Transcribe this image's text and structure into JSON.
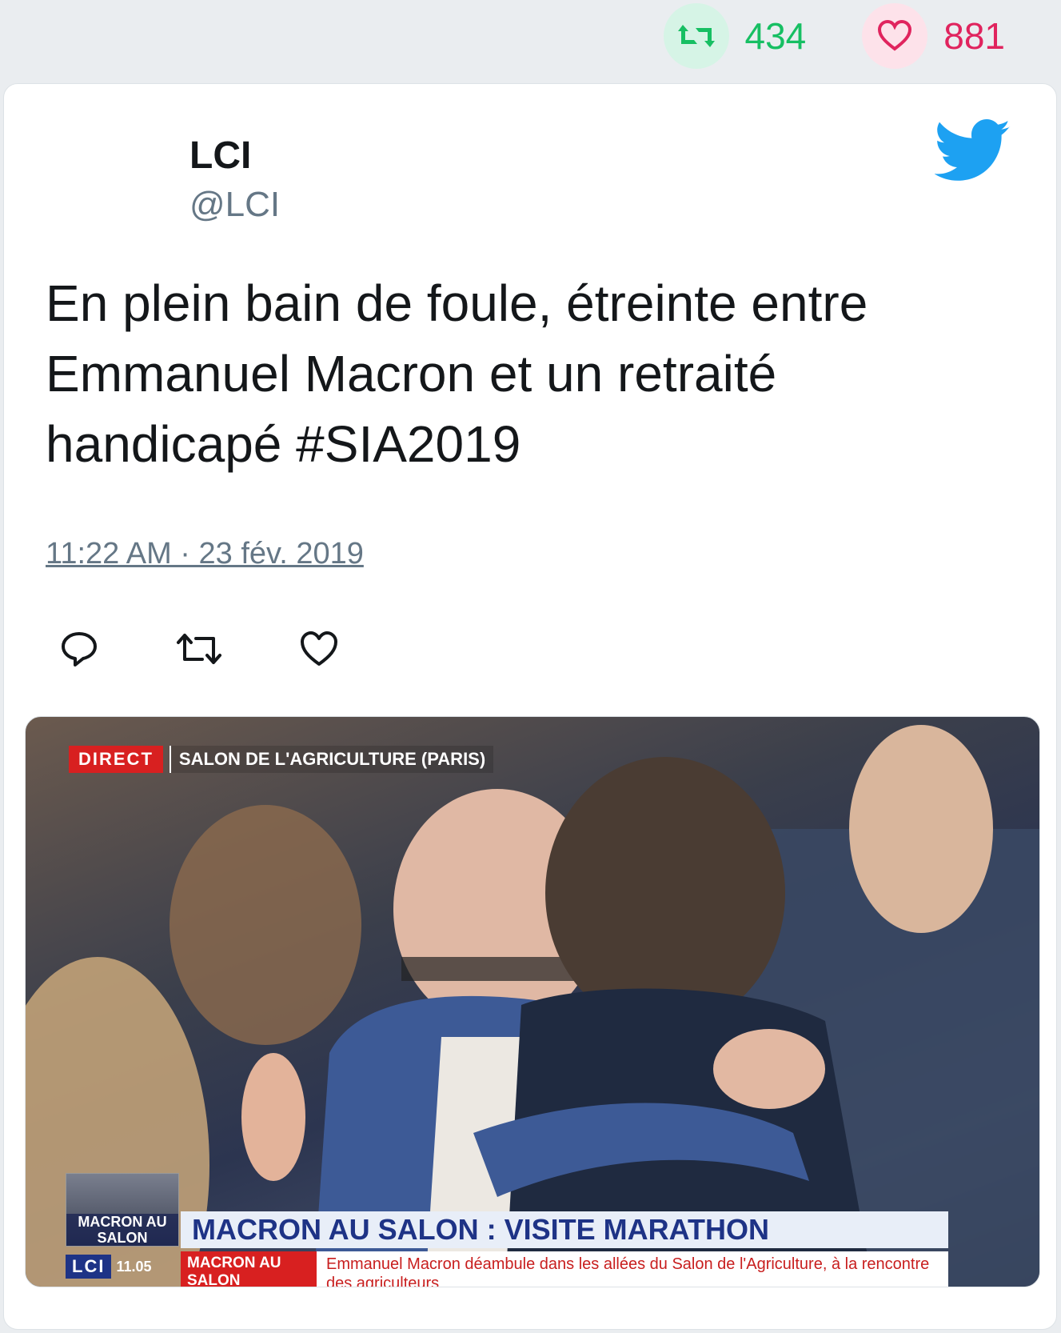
{
  "stats": {
    "retweet_count": "434",
    "like_count": "881",
    "retweet_color": "#17bf63",
    "like_color": "#e0245e"
  },
  "tweet": {
    "author_name": "LCI",
    "author_handle": "@LCI",
    "text": "En plein bain de foule, étreinte entre Emmanuel Macron et un retraité handicapé #SIA2019",
    "timestamp": "11:22 AM · 23 fév. 2019",
    "icons": [
      "reply-icon",
      "retweet-icon",
      "like-icon",
      "twitter-bird-icon"
    ]
  },
  "media": {
    "live_label": "DIRECT",
    "location": "SALON DE L'AGRICULTURE (PARIS)",
    "thumb_label": "MACRON AU SALON",
    "headline": "MACRON AU SALON : VISITE MARATHON",
    "channel": "LCI",
    "clock": "11.05",
    "subtopic": "MACRON AU SALON",
    "subtitle": "Emmanuel Macron déambule dans les allées du Salon de l'Agriculture, à la rencontre des agriculteurs"
  }
}
